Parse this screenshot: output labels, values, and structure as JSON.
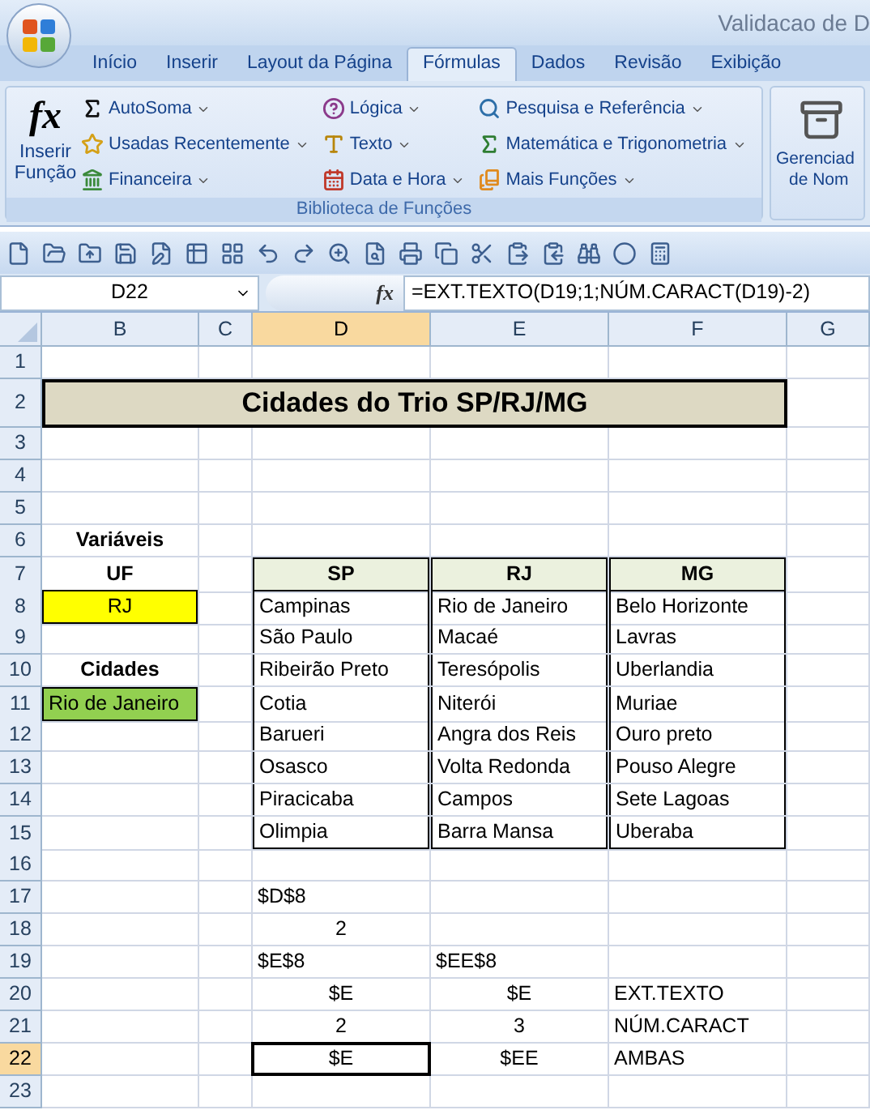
{
  "window": {
    "title": "Validacao de D"
  },
  "tabs": [
    {
      "label": "Início",
      "selected": false
    },
    {
      "label": "Inserir",
      "selected": false
    },
    {
      "label": "Layout da Página",
      "selected": false
    },
    {
      "label": "Fórmulas",
      "selected": true
    },
    {
      "label": "Dados",
      "selected": false
    },
    {
      "label": "Revisão",
      "selected": false
    },
    {
      "label": "Exibição",
      "selected": false
    }
  ],
  "ribbon": {
    "insert_function": {
      "symbol": "fx",
      "lines": [
        "Inserir",
        "Função"
      ]
    },
    "commands": [
      {
        "label": "AutoSoma",
        "kind": "sum"
      },
      {
        "label": "Usadas Recentemente",
        "kind": "recent"
      },
      {
        "label": "Financeira",
        "kind": "finance"
      },
      {
        "label": "Lógica",
        "kind": "logic"
      },
      {
        "label": "Texto",
        "kind": "text"
      },
      {
        "label": "Data e Hora",
        "kind": "date"
      },
      {
        "label": "Pesquisa e Referência",
        "kind": "lookup"
      },
      {
        "label": "Matemática e Trigonometria",
        "kind": "math"
      },
      {
        "label": "Mais Funções",
        "kind": "more"
      }
    ],
    "group_label": "Biblioteca de Funções",
    "name_manager": {
      "lines": [
        "Gerenciad",
        "de Nom"
      ]
    }
  },
  "formula_bar": {
    "name_box": "D22",
    "symbol": "fx",
    "formula": "=EXT.TEXTO(D19;1;NÚM.CARACT(D19)-2)"
  },
  "sheet": {
    "columns": [
      {
        "label": "B",
        "selected": false
      },
      {
        "label": "C",
        "selected": false
      },
      {
        "label": "D",
        "selected": true
      },
      {
        "label": "E",
        "selected": false
      },
      {
        "label": "F",
        "selected": false
      },
      {
        "label": "G",
        "selected": false
      }
    ],
    "rows": [
      {
        "number": "1",
        "selected": false
      },
      {
        "number": "2",
        "selected": false,
        "cells": {
          "B": {
            "text": "Cidades do Trio SP/RJ/MG",
            "kind": "title",
            "selected": false
          }
        }
      },
      {
        "number": "3",
        "selected": false
      },
      {
        "number": "4",
        "selected": false
      },
      {
        "number": "5",
        "selected": false
      },
      {
        "number": "6",
        "selected": false,
        "cells": {
          "B": {
            "text": "Variáveis",
            "kind": "label",
            "selected": false
          }
        }
      },
      {
        "number": "7",
        "selected": false,
        "cells": {
          "B": {
            "text": "UF",
            "kind": "label",
            "selected": false
          },
          "D": {
            "text": "SP",
            "kind": "header",
            "selected": false
          },
          "E": {
            "text": "RJ",
            "kind": "header",
            "selected": false
          },
          "F": {
            "text": "MG",
            "kind": "header",
            "selected": false
          }
        }
      },
      {
        "number": "8",
        "selected": false,
        "cells": {
          "B": {
            "text": "RJ",
            "kind": "input",
            "color": "#ffff00",
            "selected": false
          },
          "D": {
            "text": "Campinas",
            "kind": "table",
            "selected": false
          },
          "E": {
            "text": "Rio de Janeiro",
            "kind": "table",
            "selected": false
          },
          "F": {
            "text": "Belo Horizonte",
            "kind": "table",
            "selected": false
          }
        }
      },
      {
        "number": "9",
        "selected": false,
        "cells": {
          "D": {
            "text": "São Paulo",
            "kind": "table",
            "selected": false
          },
          "E": {
            "text": "Macaé",
            "kind": "table",
            "selected": false
          },
          "F": {
            "text": "Lavras",
            "kind": "table",
            "selected": false
          }
        }
      },
      {
        "number": "10",
        "selected": false,
        "cells": {
          "B": {
            "text": "Cidades",
            "kind": "label",
            "selected": false
          },
          "D": {
            "text": "Ribeirão Preto",
            "kind": "table",
            "selected": false
          },
          "E": {
            "text": "Teresópolis",
            "kind": "table",
            "selected": false
          },
          "F": {
            "text": "Uberlandia",
            "kind": "table",
            "selected": false
          }
        }
      },
      {
        "number": "11",
        "selected": false,
        "cells": {
          "B": {
            "text": "Rio de Janeiro",
            "kind": "input-text",
            "color": "#92d050",
            "selected": false
          },
          "D": {
            "text": "Cotia",
            "kind": "table",
            "selected": false
          },
          "E": {
            "text": "Niterói",
            "kind": "table",
            "selected": false
          },
          "F": {
            "text": "Muriae",
            "kind": "table",
            "selected": false
          }
        }
      },
      {
        "number": "12",
        "selected": false,
        "cells": {
          "D": {
            "text": "Barueri",
            "kind": "table",
            "selected": false
          },
          "E": {
            "text": "Angra dos Reis",
            "kind": "table",
            "selected": false
          },
          "F": {
            "text": "Ouro preto",
            "kind": "table",
            "selected": false
          }
        }
      },
      {
        "number": "13",
        "selected": false,
        "cells": {
          "D": {
            "text": "Osasco",
            "kind": "table",
            "selected": false
          },
          "E": {
            "text": "Volta Redonda",
            "kind": "table",
            "selected": false
          },
          "F": {
            "text": "Pouso Alegre",
            "kind": "table",
            "selected": false
          }
        }
      },
      {
        "number": "14",
        "selected": false,
        "cells": {
          "D": {
            "text": "Piracicaba",
            "kind": "table",
            "selected": false
          },
          "E": {
            "text": "Campos",
            "kind": "table",
            "selected": false
          },
          "F": {
            "text": "Sete Lagoas",
            "kind": "table",
            "selected": false
          }
        }
      },
      {
        "number": "15",
        "selected": false,
        "cells": {
          "D": {
            "text": "Olimpia",
            "kind": "table-end",
            "selected": false
          },
          "E": {
            "text": "Barra Mansa",
            "kind": "table-end",
            "selected": false
          },
          "F": {
            "text": "Uberaba",
            "kind": "table-end",
            "selected": false
          }
        }
      },
      {
        "number": "16",
        "selected": false
      },
      {
        "number": "17",
        "selected": false,
        "cells": {
          "D": {
            "text": "$D$8",
            "kind": "text",
            "selected": false
          }
        }
      },
      {
        "number": "18",
        "selected": false,
        "cells": {
          "D": {
            "text": "2",
            "kind": "centered",
            "selected": false
          }
        }
      },
      {
        "number": "19",
        "selected": false,
        "cells": {
          "D": {
            "text": "$E$8",
            "kind": "text",
            "selected": false
          },
          "E": {
            "text": "$EE$8",
            "kind": "text",
            "selected": false
          }
        }
      },
      {
        "number": "20",
        "selected": false,
        "cells": {
          "D": {
            "text": "$E",
            "kind": "centered",
            "selected": false
          },
          "E": {
            "text": "$E",
            "kind": "centered",
            "selected": false
          },
          "F": {
            "text": "EXT.TEXTO",
            "kind": "text",
            "selected": false
          }
        }
      },
      {
        "number": "21",
        "selected": false,
        "cells": {
          "D": {
            "text": "2",
            "kind": "centered",
            "selected": false
          },
          "E": {
            "text": "3",
            "kind": "centered",
            "selected": false
          },
          "F": {
            "text": "NÚM.CARACT",
            "kind": "text",
            "selected": false
          }
        }
      },
      {
        "number": "22",
        "selected": true,
        "cells": {
          "D": {
            "text": "$E",
            "kind": "centered",
            "selected": true
          },
          "E": {
            "text": "$EE",
            "kind": "centered",
            "selected": false
          },
          "F": {
            "text": "AMBAS",
            "kind": "text",
            "selected": false
          }
        }
      },
      {
        "number": "23",
        "selected": false
      }
    ]
  }
}
